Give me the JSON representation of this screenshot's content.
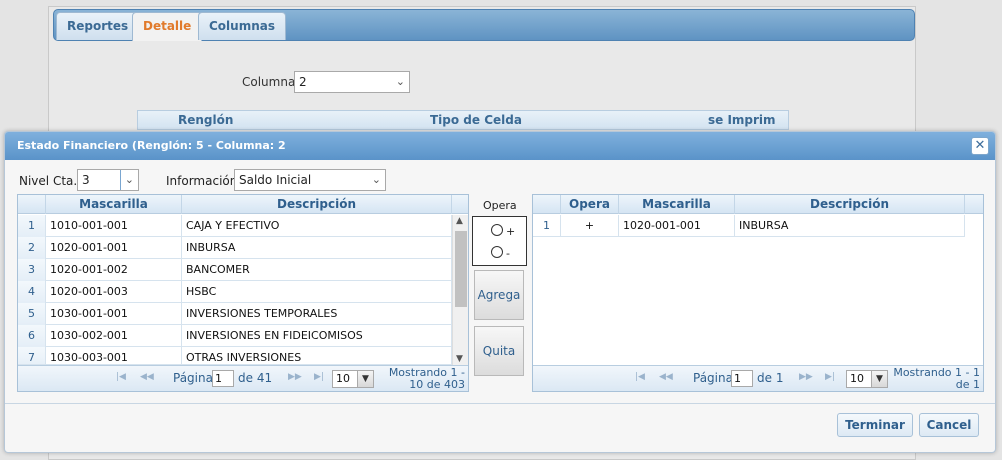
{
  "background": {
    "tabs": [
      {
        "label": "Reportes"
      },
      {
        "label": "Detalle"
      },
      {
        "label": "Columnas"
      }
    ],
    "columna_label": "Columna",
    "columna_value": "2",
    "grid_headers": [
      "Renglón",
      "Tipo de Celda",
      "se Imprim"
    ]
  },
  "dialog": {
    "title": "Estado Financiero (Renglón: 5 - Columna: 2",
    "nivel_label": "Nivel Cta.",
    "nivel_value": "3",
    "info_label": "Información",
    "info_value": "Saldo Inicial",
    "left_grid": {
      "headers": [
        "Mascarilla",
        "Descripción"
      ],
      "rows": [
        {
          "n": "1",
          "mascarilla": "1010-001-001",
          "descripcion": "CAJA Y EFECTIVO"
        },
        {
          "n": "2",
          "mascarilla": "1020-001-001",
          "descripcion": "INBURSA"
        },
        {
          "n": "3",
          "mascarilla": "1020-001-002",
          "descripcion": "BANCOMER"
        },
        {
          "n": "4",
          "mascarilla": "1020-001-003",
          "descripcion": "HSBC"
        },
        {
          "n": "5",
          "mascarilla": "1030-001-001",
          "descripcion": "INVERSIONES TEMPORALES"
        },
        {
          "n": "6",
          "mascarilla": "1030-002-001",
          "descripcion": "INVERSIONES EN FIDEICOMISOS"
        },
        {
          "n": "7",
          "mascarilla": "1030-003-001",
          "descripcion": "OTRAS INVERSIONES"
        }
      ],
      "pager": {
        "page_label": "Página",
        "page_value": "1",
        "of_text": "de 41",
        "per_page": "10",
        "showing_line1": "Mostrando 1 -",
        "showing_line2": "10 de 403"
      }
    },
    "opera": {
      "label": "Opera",
      "plus": "+",
      "minus": "-",
      "add_label": "Agrega",
      "remove_label": "Quita"
    },
    "right_grid": {
      "headers": [
        "Opera",
        "Mascarilla",
        "Descripción"
      ],
      "rows": [
        {
          "n": "1",
          "opera": "+",
          "mascarilla": "1020-001-001",
          "descripcion": "INBURSA"
        }
      ],
      "pager": {
        "page_label": "Página",
        "page_value": "1",
        "of_text": "de 1",
        "per_page": "10",
        "showing_line1": "Mostrando 1 - 1",
        "showing_line2": "de 1"
      }
    },
    "footer": {
      "finish_label": "Terminar",
      "cancel_label": "Cancel"
    }
  }
}
